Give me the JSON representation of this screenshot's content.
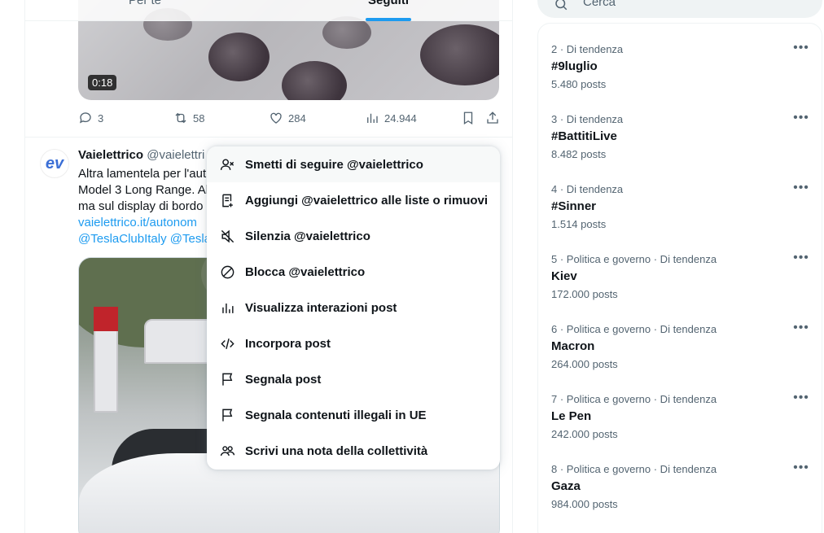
{
  "tabs": {
    "for_you": "Per te",
    "following": "Seguiti"
  },
  "previous_post": {
    "video_time": "0:18",
    "replies": "3",
    "reposts": "58",
    "likes": "284",
    "views": "24.944"
  },
  "post": {
    "name": "Vaielettrico",
    "handle": "@vaielettri",
    "avatar_text": "ev",
    "lines": [
      "Altra lamentela per l'aut",
      "Model 3 Long Range. Al",
      "ma sul display di bordo"
    ],
    "link_line": "vaielettrico.it/autonom",
    "mentions_line": "@TeslaClubItaly @Tesla"
  },
  "menu": {
    "items": [
      {
        "icon": "unfollow-icon",
        "label": "Smetti di seguire @vaielettrico"
      },
      {
        "icon": "list-icon",
        "label": "Aggiungi @vaielettrico alle liste o rimuovi"
      },
      {
        "icon": "mute-icon",
        "label": "Silenzia @vaielettrico"
      },
      {
        "icon": "block-icon",
        "label": "Blocca @vaielettrico"
      },
      {
        "icon": "analytics-icon",
        "label": "Visualizza interazioni post"
      },
      {
        "icon": "embed-icon",
        "label": "Incorpora post"
      },
      {
        "icon": "flag-icon",
        "label": "Segnala post"
      },
      {
        "icon": "flag-icon",
        "label": "Segnala contenuti illegali in UE"
      },
      {
        "icon": "community-icon",
        "label": "Scrivi una nota della collettività"
      }
    ]
  },
  "search": {
    "placeholder": "Cerca"
  },
  "trends": [
    {
      "meta": "2 · Di tendenza",
      "title": "#9luglio",
      "count": "5.480 posts"
    },
    {
      "meta": "3 · Di tendenza",
      "title": "#BattitiLive",
      "count": "8.482 posts"
    },
    {
      "meta": "4 · Di tendenza",
      "title": "#Sinner",
      "count": "1.514 posts"
    },
    {
      "meta": "5 · Politica e governo · Di tendenza",
      "title": "Kiev",
      "count": "172.000 posts"
    },
    {
      "meta": "6 · Politica e governo · Di tendenza",
      "title": "Macron",
      "count": "264.000 posts"
    },
    {
      "meta": "7 · Politica e governo · Di tendenza",
      "title": "Le Pen",
      "count": "242.000 posts"
    },
    {
      "meta": "8 · Politica e governo · Di tendenza",
      "title": "Gaza",
      "count": "984.000 posts"
    }
  ],
  "colors": {
    "accent": "#1d9bf0",
    "text": "#0f1419",
    "secondary": "#536471"
  }
}
